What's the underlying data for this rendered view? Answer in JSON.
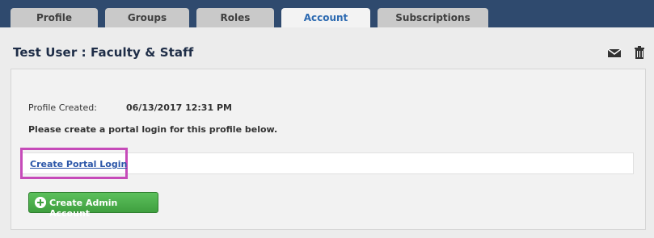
{
  "tabs": [
    {
      "label": "Profile"
    },
    {
      "label": "Groups"
    },
    {
      "label": "Roles"
    },
    {
      "label": "Account"
    },
    {
      "label": "Subscriptions"
    }
  ],
  "page": {
    "title": "Test User : Faculty & Staff"
  },
  "profile": {
    "created_label": "Profile Created:",
    "created_value": "06/13/2017 12:31 PM",
    "instruction": "Please create a portal login for this profile below."
  },
  "actions": {
    "create_portal_login": "Create Portal Login",
    "create_admin_account": "Create Admin Account"
  },
  "icons": {
    "mail": "mail-icon",
    "delete": "trash-icon",
    "add": "plus-circle-icon"
  },
  "colors": {
    "nav_bg": "#2f4a6e",
    "active_tab_text": "#2c6ab1",
    "link": "#2b56a8",
    "highlight": "#c64bb9",
    "button_green": "#4caf50"
  }
}
